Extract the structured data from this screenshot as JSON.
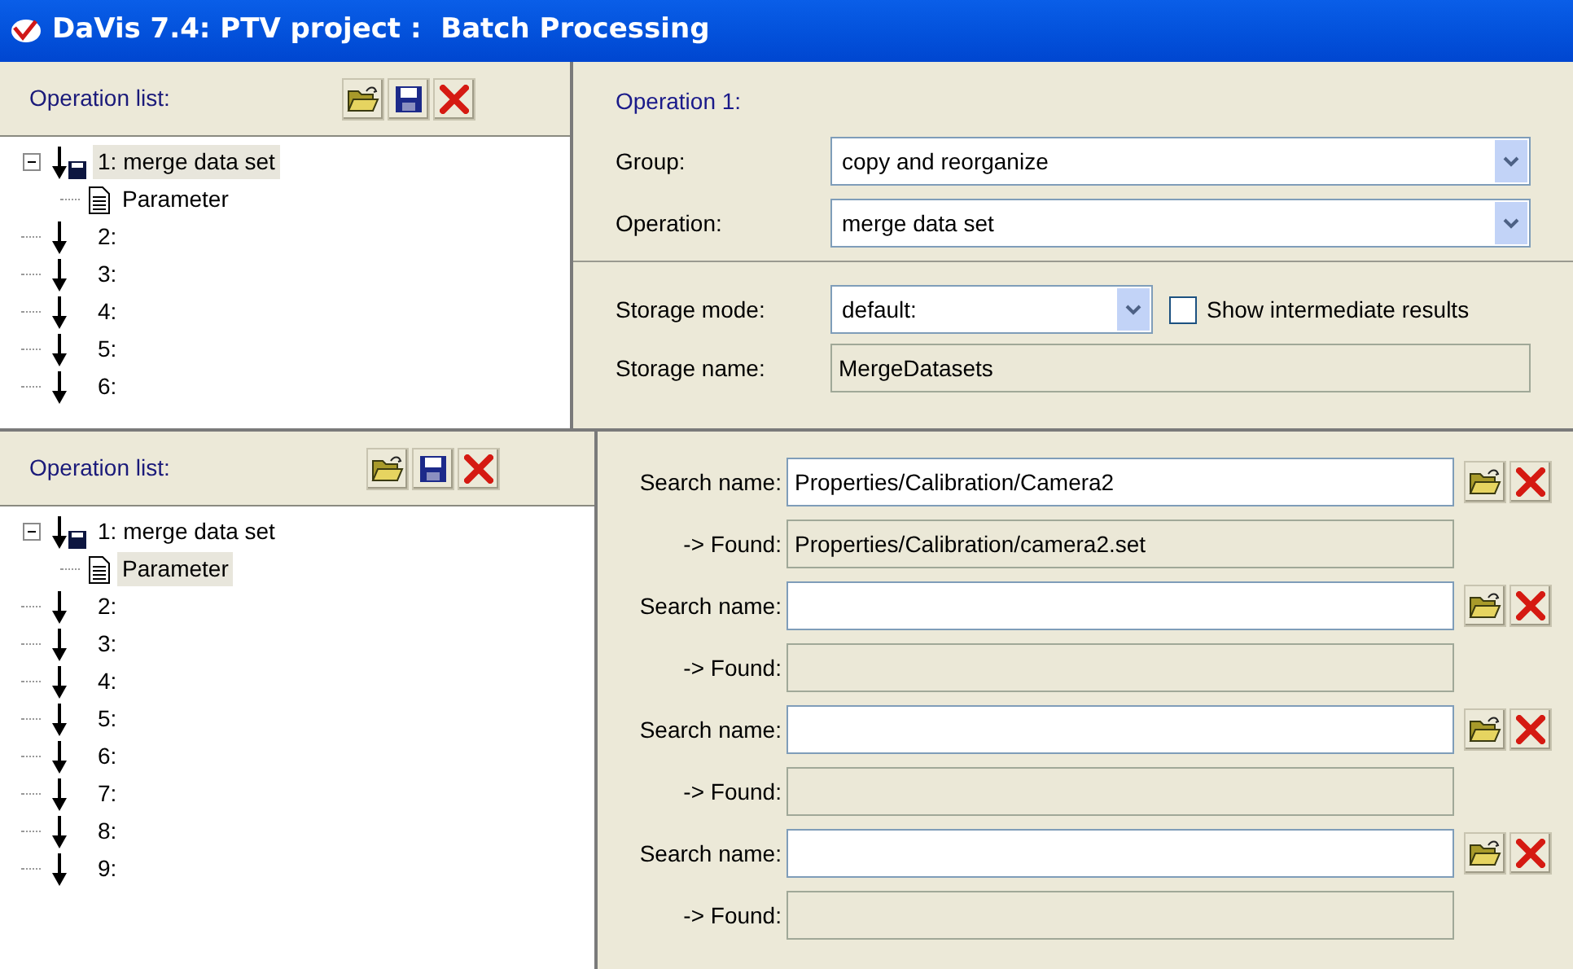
{
  "window": {
    "title": "DaVis 7.4: PTV project :  Batch Processing"
  },
  "top_panel": {
    "operation_list": {
      "label": "Operation list:",
      "items": [
        {
          "label": "1: merge data set",
          "kind": "stored",
          "selected": true,
          "expanded": true,
          "children": [
            {
              "label": "Parameter",
              "kind": "parameter",
              "selected": false
            }
          ]
        },
        {
          "label": "2:",
          "kind": "step",
          "selected": false
        },
        {
          "label": "3:",
          "kind": "step",
          "selected": false
        },
        {
          "label": "4:",
          "kind": "step",
          "selected": false
        },
        {
          "label": "5:",
          "kind": "step",
          "selected": false
        },
        {
          "label": "6:",
          "kind": "step",
          "selected": false
        }
      ]
    },
    "operation": {
      "heading": "Operation 1:",
      "group_label": "Group:",
      "group_value": "copy and reorganize",
      "operation_label": "Operation:",
      "operation_value": "merge data set",
      "storage_mode_label": "Storage mode:",
      "storage_mode_value": "default:",
      "show_intermediate": {
        "label": "Show intermediate results",
        "checked": false
      },
      "storage_name_label": "Storage name:",
      "storage_name_value": "MergeDatasets"
    }
  },
  "bottom_panel": {
    "operation_list": {
      "label": "Operation list:",
      "items": [
        {
          "label": "1: merge data set",
          "kind": "stored",
          "selected": false,
          "expanded": true,
          "children": [
            {
              "label": "Parameter",
              "kind": "parameter",
              "selected": true
            }
          ]
        },
        {
          "label": "2:",
          "kind": "step",
          "selected": false
        },
        {
          "label": "3:",
          "kind": "step",
          "selected": false
        },
        {
          "label": "4:",
          "kind": "step",
          "selected": false
        },
        {
          "label": "5:",
          "kind": "step",
          "selected": false
        },
        {
          "label": "6:",
          "kind": "step",
          "selected": false
        },
        {
          "label": "7:",
          "kind": "step",
          "selected": false
        },
        {
          "label": "8:",
          "kind": "step",
          "selected": false
        },
        {
          "label": "9:",
          "kind": "step",
          "selected": false
        }
      ]
    },
    "search_entries": [
      {
        "search_label": "Search name:",
        "search_value": "Properties/Calibration/Camera2",
        "found_label": "-> Found:",
        "found_value": "Properties/Calibration/camera2.set"
      },
      {
        "search_label": "Search name:",
        "found_label": "-> Found:"
      },
      {
        "search_label": "Search name:",
        "found_label": "-> Found:"
      },
      {
        "search_label": "Search name:",
        "found_label": "-> Found:"
      }
    ]
  }
}
